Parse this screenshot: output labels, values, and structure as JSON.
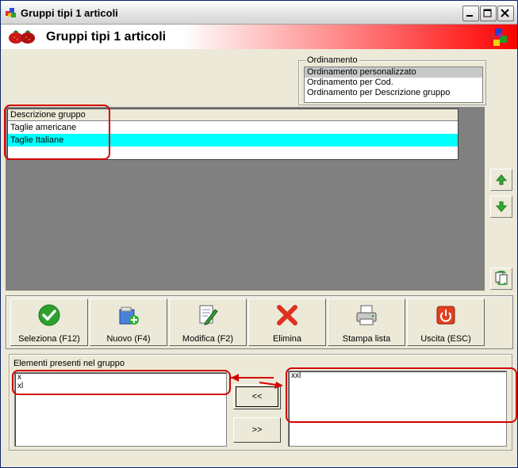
{
  "window": {
    "title": "Gruppi tipi 1 articoli"
  },
  "banner": {
    "title": "Gruppi tipi 1 articoli"
  },
  "ordinamento": {
    "label": "Ordinamento",
    "options": [
      "Ordinamento personalizzato",
      "Ordinamento per Cod.",
      "Ordinamento per Descrizione gruppo"
    ],
    "selected_index": 0
  },
  "grid": {
    "header": "Descrizione gruppo",
    "rows": [
      "Taglie americane",
      "Taglie Italiane"
    ],
    "selected_index": 1,
    "selected_color": "#00ffff"
  },
  "side_buttons": [
    "arrow-up-icon",
    "arrow-down-icon",
    "refresh-icon"
  ],
  "toolbar": {
    "seleziona": "Seleziona (F12)",
    "nuovo": "Nuovo (F4)",
    "modifica": "Modifica (F2)",
    "elimina": "Elimina",
    "stampa": "Stampa lista",
    "uscita": "Uscita (ESC)"
  },
  "elements": {
    "label": "Elementi presenti nel gruppo",
    "in_group": [
      "x",
      "xl"
    ],
    "available": [
      "xxl"
    ],
    "move_left": "<<",
    "move_right": ">>"
  },
  "colors": {
    "annotation": "#d40000",
    "banner_end": "#ff0000"
  }
}
